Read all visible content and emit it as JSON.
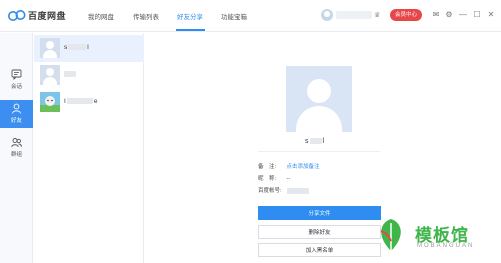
{
  "app": {
    "title": "百度网盘"
  },
  "nav": {
    "tabs": [
      {
        "label": "我的网盘"
      },
      {
        "label": "传输列表"
      },
      {
        "label": "好友分享"
      },
      {
        "label": "功能宝箱"
      }
    ],
    "active_index": 2
  },
  "topbar": {
    "member_label": "会员中心"
  },
  "rail": {
    "items": [
      {
        "label": "会话",
        "icon": "chat-icon"
      },
      {
        "label": "好友",
        "icon": "friend-icon"
      },
      {
        "label": "群组",
        "icon": "group-icon"
      }
    ],
    "active_index": 1
  },
  "friends": [
    {
      "name_visible": "s",
      "name_tail": "l"
    },
    {
      "name_visible": "",
      "name_tail": ""
    },
    {
      "name_visible": "I",
      "name_tail": "e"
    }
  ],
  "profile": {
    "name_visible": "s",
    "name_tail": "l",
    "fields": [
      {
        "label": "备　注:",
        "value": "点击添加备注",
        "is_link": true
      },
      {
        "label": "昵　称:",
        "value": "--",
        "is_link": false
      },
      {
        "label": "百度帐号:",
        "value": "",
        "is_link": false
      }
    ]
  },
  "actions": [
    {
      "label": "分享文件",
      "primary": true
    },
    {
      "label": "删除好友",
      "primary": false
    },
    {
      "label": "加入黑名单",
      "primary": false
    }
  ],
  "watermark": {
    "text": "模板馆",
    "sub": "MOBANGUAN"
  },
  "colors": {
    "accent": "#2f8cf0",
    "member": "#e8474a",
    "watermark": "#3fb54a"
  }
}
